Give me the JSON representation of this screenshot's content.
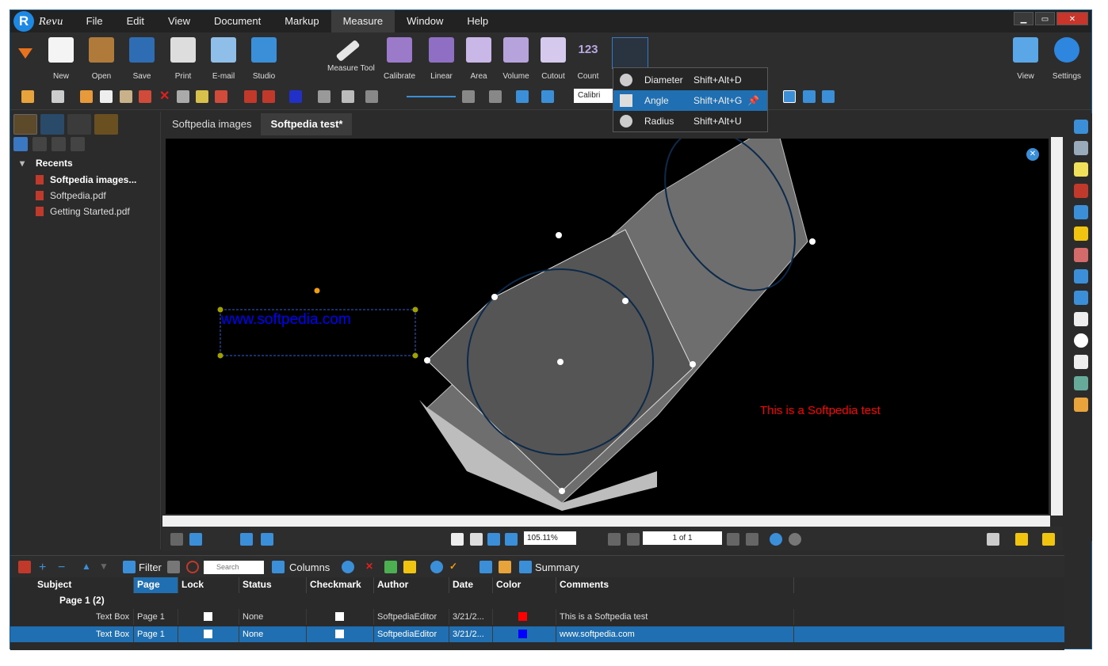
{
  "app": {
    "name": "Revu"
  },
  "menu": [
    "File",
    "Edit",
    "View",
    "Document",
    "Markup",
    "Measure",
    "Window",
    "Help"
  ],
  "ribbon_left": [
    {
      "label": "New",
      "icon": "new-document-icon"
    },
    {
      "label": "Open",
      "icon": "folder-icon"
    },
    {
      "label": "Save",
      "icon": "save-icon"
    },
    {
      "label": "Print",
      "icon": "printer-icon"
    },
    {
      "label": "E-mail",
      "icon": "email-icon"
    },
    {
      "label": "Studio",
      "icon": "studio-icon"
    }
  ],
  "ribbon_measure": [
    {
      "label": "Measure Tool",
      "icon": "ruler-icon"
    },
    {
      "label": "Calibrate",
      "icon": "compass-icon"
    },
    {
      "label": "Linear",
      "icon": "linear-icon"
    },
    {
      "label": "Area",
      "icon": "area-icon"
    },
    {
      "label": "Volume",
      "icon": "cube-icon"
    },
    {
      "label": "Cutout",
      "icon": "cutout-icon"
    },
    {
      "label": "Count",
      "icon": "count-icon"
    }
  ],
  "ribbon_right": [
    {
      "label": "View",
      "icon": "monitor-icon"
    },
    {
      "label": "Settings",
      "icon": "gear-icon"
    }
  ],
  "count_icon_text": "123",
  "font_name": "Calibri",
  "measure_dropdown": [
    {
      "label": "Diameter",
      "shortcut": "Shift+Alt+D"
    },
    {
      "label": "Angle",
      "shortcut": "Shift+Alt+G"
    },
    {
      "label": "Radius",
      "shortcut": "Shift+Alt+U"
    }
  ],
  "left_panel": {
    "recents_title": "Recents",
    "files": [
      "Softpedia images...",
      "Softpedia.pdf",
      "Getting Started.pdf"
    ]
  },
  "doc_tabs": [
    "Softpedia images",
    "Softpedia test*"
  ],
  "canvas": {
    "blue_text": "www.softpedia.com",
    "red_text": "This is a Softpedia test",
    "blue_color": "#0000ff",
    "red_color": "#ff0000"
  },
  "nav": {
    "zoom": "105.11%",
    "page": "1 of 1"
  },
  "markups_toolbar": {
    "filter": "Filter",
    "search_placeholder": "Search",
    "columns": "Columns",
    "summary": "Summary"
  },
  "grid": {
    "headers": [
      "Subject",
      "Page",
      "Lock",
      "Status",
      "Checkmark",
      "Author",
      "Date",
      "Color",
      "Comments"
    ],
    "group": "Page 1 (2)",
    "rows": [
      {
        "subject": "Text Box",
        "page": "Page 1",
        "status": "None",
        "author": "SoftpediaEditor",
        "date": "3/21/2...",
        "color": "#ff0000",
        "comments": "This is a Softpedia test"
      },
      {
        "subject": "Text Box",
        "page": "Page 1",
        "status": "None",
        "author": "SoftpediaEditor",
        "date": "3/21/2...",
        "color": "#0000ff",
        "comments": "www.softpedia.com"
      }
    ]
  }
}
